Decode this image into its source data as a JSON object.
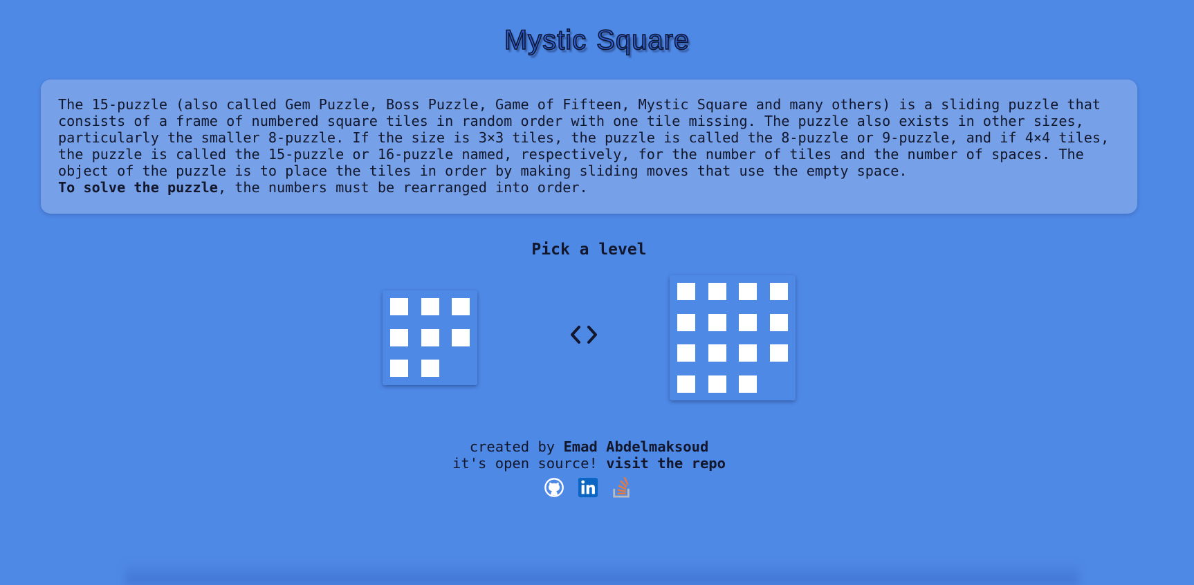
{
  "header": {
    "title_word1": "Mystic",
    "title_word2": "Square"
  },
  "description": {
    "paragraph": "The 15-puzzle (also called Gem Puzzle, Boss Puzzle, Game of Fifteen, Mystic Square and many others) is a sliding puzzle that consists of a frame of numbered square tiles in random order with one tile missing. The puzzle also exists in other sizes, particularly the smaller 8-puzzle. If the size is 3×3 tiles, the puzzle is called the 8-puzzle or 9-puzzle, and if 4×4 tiles, the puzzle is called the 15-puzzle or 16-puzzle named, respectively, for the number of tiles and the number of spaces. The object of the puzzle is to place the tiles in order by making sliding moves that use the empty space.",
    "goal_bold": "To solve the puzzle",
    "goal_rest": ", the numbers must be rearranged into order."
  },
  "levels": {
    "heading": "Pick a level",
    "options": [
      {
        "grid": 3,
        "tiles": 8
      },
      {
        "grid": 4,
        "tiles": 15
      }
    ],
    "switch_icon": "chevrons-left-right-icon"
  },
  "footer": {
    "created_prefix": "created by ",
    "author": "Emad Abdelmaksoud",
    "open_source_prefix": "it's open source! ",
    "repo_link": "visit the repo",
    "social_icons": [
      "github-icon",
      "linkedin-icon",
      "stackoverflow-icon"
    ]
  },
  "colors": {
    "background": "#4f89e6",
    "panel": "#76a0e8",
    "text": "#12172b",
    "tile": "#ffffff",
    "linkedin": "#0a66c2",
    "stackoverflow": "#e87a3c"
  }
}
